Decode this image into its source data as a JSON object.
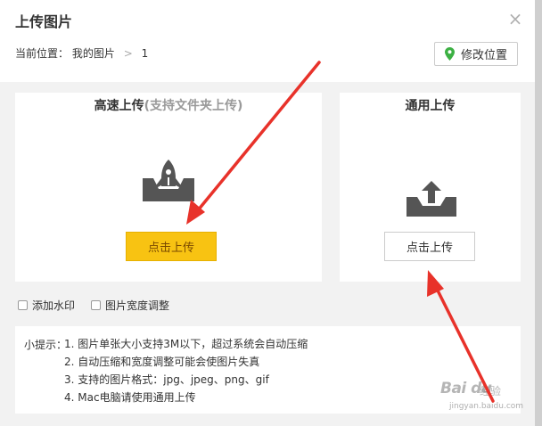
{
  "dialog": {
    "title": "上传图片",
    "close_symbol": "×",
    "breadcrumb": {
      "label": "当前位置：",
      "album": "我的图片",
      "separator": ">",
      "page": "1"
    },
    "change_location_label": "修改位置"
  },
  "fast_upload": {
    "title": "高速上传",
    "subtitle": "(支持文件夹上传)",
    "button_label": "点击上传",
    "icon": "rocket-upload-icon"
  },
  "common_upload": {
    "title": "通用上传",
    "button_label": "点击上传",
    "icon": "tray-upload-icon"
  },
  "options": [
    {
      "label": "添加水印",
      "checked": false
    },
    {
      "label": "图片宽度调整",
      "checked": false
    }
  ],
  "tips": {
    "label": "小提示：",
    "items": [
      "1. 图片单张大小支持3M以下，超过系统会自动压缩",
      "2. 自动压缩和宽度调整可能会使图片失真",
      "3. 支持的图片格式：jpg、jpeg、png、gif",
      "4. Mac电脑请使用通用上传"
    ]
  },
  "watermark": {
    "logo": "Bai du",
    "sub": "经验",
    "url": "jingyan.baidu.com"
  },
  "colors": {
    "accent_yellow": "#f8c312",
    "pin_green": "#3cb043",
    "annotation_red": "#e8322a",
    "icon_gray": "#555555"
  }
}
